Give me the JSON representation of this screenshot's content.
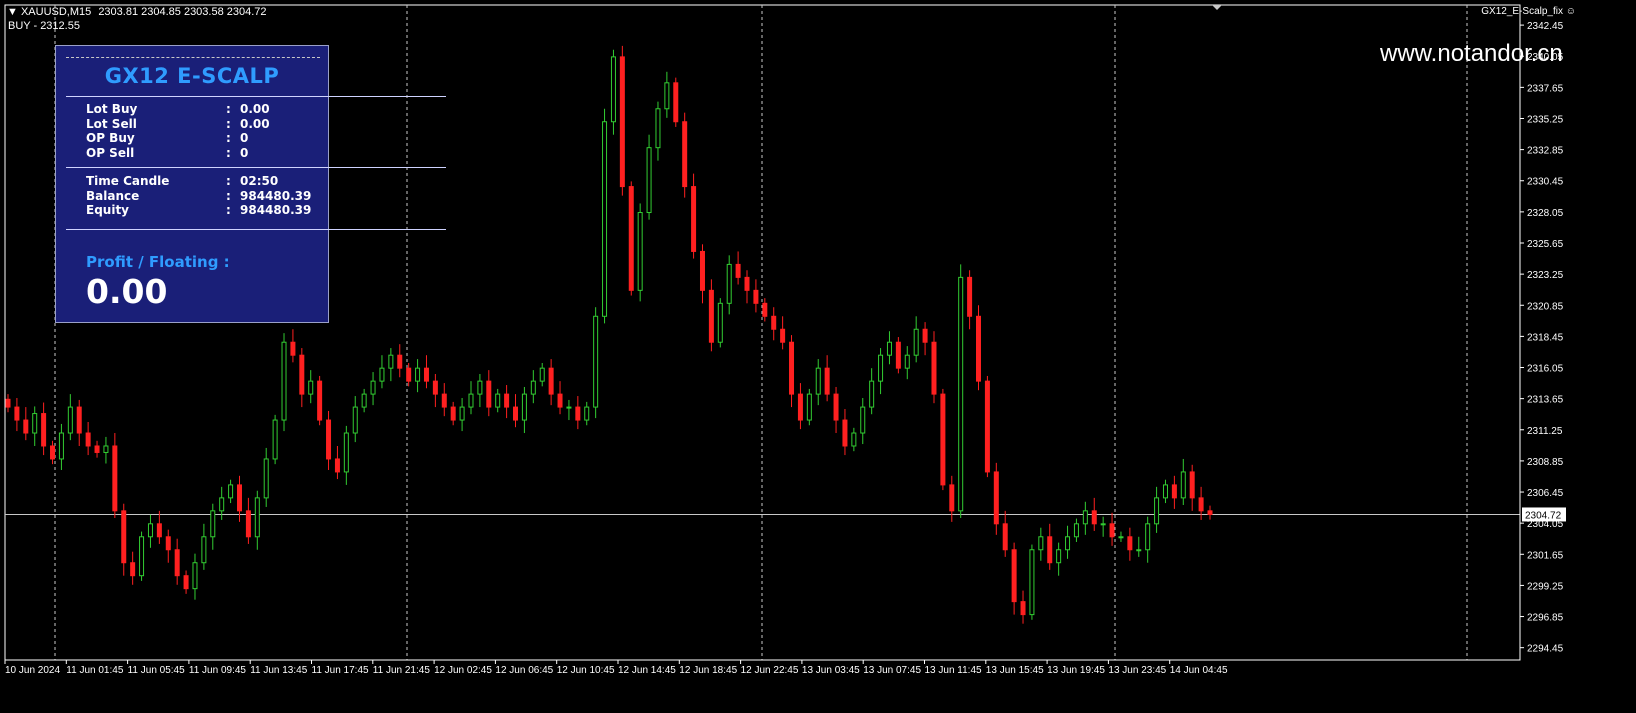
{
  "header": {
    "symbol": "XAUUSD,M15",
    "ohlc": "2303.81 2304.85 2303.58 2304.72",
    "buy_line": "BUY - 2312.55"
  },
  "ea_name": "GX12_E-Scalp_fix",
  "watermark": "www.notandor.cn",
  "panel": {
    "title": "GX12 E-SCALP",
    "rows1": [
      {
        "label": "Lot Buy",
        "value": "0.00"
      },
      {
        "label": "Lot Sell",
        "value": "0.00"
      },
      {
        "label": "OP Buy",
        "value": "0"
      },
      {
        "label": "OP Sell",
        "value": "0"
      }
    ],
    "rows2": [
      {
        "label": "Time Candle",
        "value": "02:50"
      },
      {
        "label": "Balance",
        "value": "984480.39"
      },
      {
        "label": "Equity",
        "value": "984480.39"
      }
    ],
    "profit_label": "Profit / Floating  :",
    "profit_value": "0.00",
    "colon": ":"
  },
  "colors": {
    "bull": "#32cd32",
    "bear": "#ff2020",
    "grid": "#c8c8c8",
    "panel_bg": "#1a1f78",
    "accent": "#2f9cff"
  },
  "chart_data": {
    "type": "candlestick",
    "ylim": [
      2293.5,
      2344.0
    ],
    "y_ticks": [
      "2342.45",
      "2340.05",
      "2337.65",
      "2335.25",
      "2332.85",
      "2330.45",
      "2328.05",
      "2325.65",
      "2323.25",
      "2320.85",
      "2318.45",
      "2316.05",
      "2313.65",
      "2311.25",
      "2308.85",
      "2306.45",
      "2304.05",
      "2301.65",
      "2299.25",
      "2296.85",
      "2294.45"
    ],
    "x_labels": [
      "10 Jun 2024",
      "11 Jun 01:45",
      "11 Jun 05:45",
      "11 Jun 09:45",
      "11 Jun 13:45",
      "11 Jun 17:45",
      "11 Jun 21:45",
      "12 Jun 02:45",
      "12 Jun 06:45",
      "12 Jun 10:45",
      "12 Jun 14:45",
      "12 Jun 18:45",
      "12 Jun 22:45",
      "13 Jun 03:45",
      "13 Jun 07:45",
      "13 Jun 11:45",
      "13 Jun 15:45",
      "13 Jun 19:45",
      "13 Jun 23:45",
      "14 Jun 04:45"
    ],
    "current_price": "2304.72",
    "closes": [
      2313,
      2312,
      2311,
      2312.5,
      2310,
      2309,
      2311,
      2313,
      2311,
      2310,
      2309.5,
      2310,
      2305,
      2301,
      2300,
      2303,
      2304,
      2303,
      2302,
      2300,
      2299,
      2301,
      2303,
      2305,
      2306,
      2307,
      2305,
      2303,
      2306,
      2309,
      2312,
      2318,
      2317,
      2314,
      2315,
      2312,
      2309,
      2308,
      2311,
      2313,
      2314,
      2315,
      2316,
      2317,
      2316,
      2315,
      2316,
      2315,
      2314,
      2313,
      2312,
      2313,
      2314,
      2315,
      2313,
      2314,
      2313,
      2312,
      2314,
      2315,
      2316,
      2314,
      2313,
      2313,
      2312,
      2313,
      2320,
      2335,
      2340,
      2330,
      2322,
      2328,
      2333,
      2336,
      2338,
      2335,
      2330,
      2325,
      2322,
      2318,
      2321,
      2324,
      2323,
      2322,
      2321,
      2320,
      2319,
      2318,
      2314,
      2312,
      2314,
      2316,
      2314,
      2312,
      2310,
      2311,
      2313,
      2315,
      2317,
      2318,
      2316,
      2317,
      2319,
      2318,
      2314,
      2307,
      2305,
      2323,
      2320,
      2315,
      2308,
      2304,
      2302,
      2298,
      2297,
      2302,
      2303,
      2301,
      2302,
      2303,
      2304,
      2305,
      2304,
      2304,
      2303,
      2303,
      2302,
      2302,
      2304,
      2306,
      2307,
      2306,
      2308,
      2306,
      2305,
      2304.72
    ]
  }
}
